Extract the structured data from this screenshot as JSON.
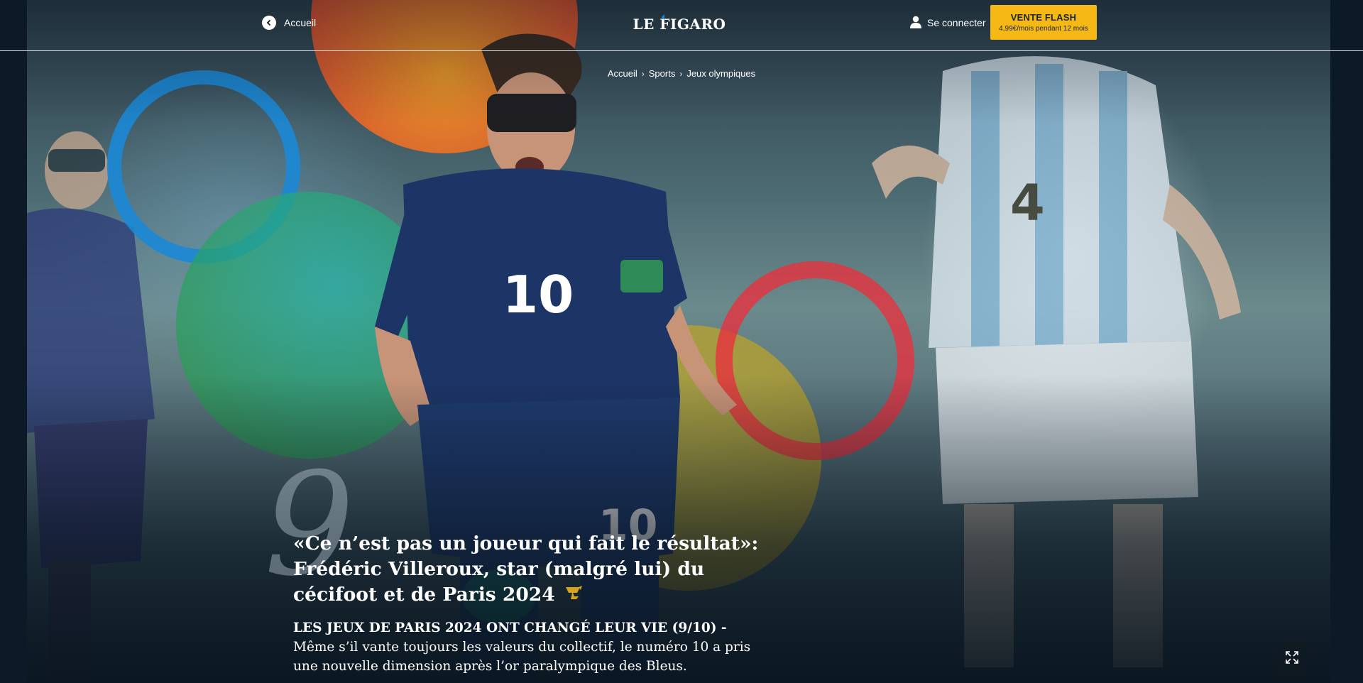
{
  "header": {
    "back_label": "Accueil",
    "logo_text": "LE FIGARO",
    "login_label": "Se connecter",
    "promo": {
      "label": "VENTE FLASH",
      "sublabel": "4,99€/mois pendant 12 mois"
    }
  },
  "breadcrumb": {
    "items": [
      "Accueil",
      "Sports",
      "Jeux olympiques"
    ]
  },
  "article": {
    "number": "9",
    "title": "«Ce n’est pas un joueur qui fait le résultat»: Frédéric Villeroux, star (malgré lui) du cécifoot et de Paris 2024",
    "kicker": "LES JEUX DE PARIS 2024 ONT CHANGÉ LEUR VIE (9/10) -",
    "summary": "Même s’il vante toujours les valeurs du collectif, le numéro 10 a pris une nouvelle dimension après l’or paralympique des Bleus.",
    "player_number": "10",
    "opponent_number": "4"
  },
  "icons": {
    "back": "chevron-left-circle-icon",
    "user": "user-icon",
    "trophy": "trophy-icon",
    "fullscreen": "expand-icon"
  },
  "colors": {
    "promo_background": "#f5b815",
    "ring_blue": "#1b88d6",
    "ring_red": "#e6323e",
    "circle_orange": "#e0472c",
    "circle_green": "#2a9d54",
    "circle_yellow": "#c9a614",
    "jersey_navy": "#1d3566"
  }
}
